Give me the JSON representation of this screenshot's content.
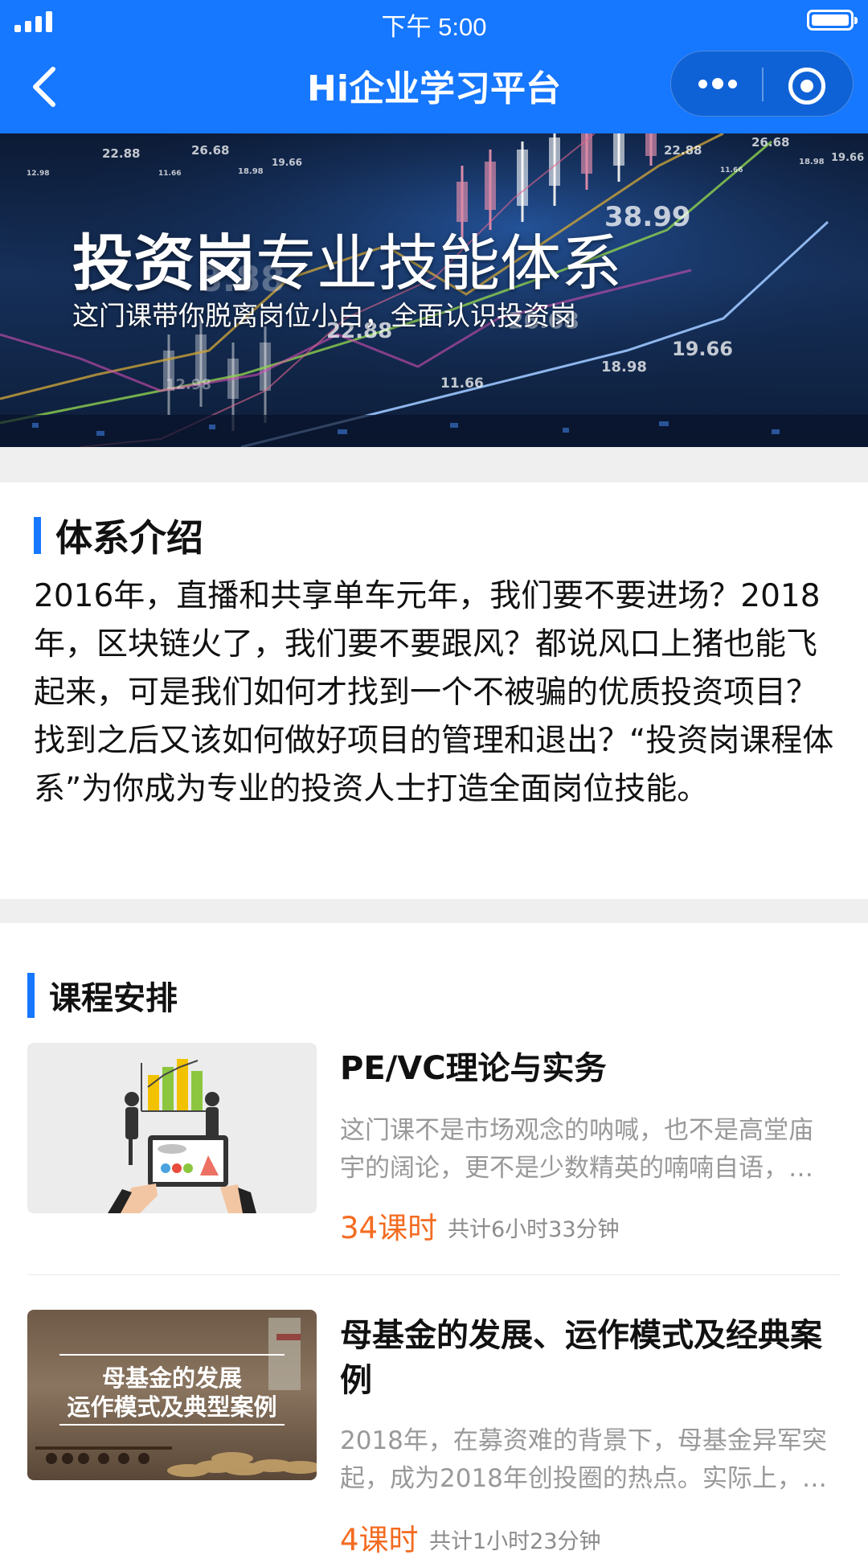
{
  "status_bar": {
    "time": "下午 5:00"
  },
  "nav": {
    "title": "Hi企业学习平台"
  },
  "banner": {
    "title_bold": "投资岗",
    "title_light": "专业技能体系",
    "subtitle": "这门课带你脱离岗位小白，全面认识投资岗",
    "bg_numbers": [
      "22.88",
      "26.68",
      "19.66",
      "18.98",
      "11.66",
      "12.98",
      "38.99",
      "26.68",
      "22.88",
      "19.66",
      "18.98",
      "11.66",
      "22.88",
      "8.88",
      "12.98"
    ]
  },
  "intro": {
    "heading": "体系介绍",
    "text": "2016年，直播和共享单车元年，我们要不要进场？2018年，区块链火了，我们要不要跟风？都说风口上猪也能飞起来，可是我们如何才找到一个不被骗的优质投资项目？找到之后又该如何做好项目的管理和退出？“投资岗课程体系”为你成为专业的投资人士打造全面岗位技能。"
  },
  "schedule": {
    "heading": "课程安排",
    "courses": [
      {
        "title": "PE/VC理论与实务",
        "desc_line1": "这门课不是市场观念的呐喊，也不是高堂庙",
        "desc_line2": "宇的阔论，更不是少数精英的喃喃自语，…",
        "lessons": "34课时",
        "duration": "共计6小时33分钟"
      },
      {
        "title": "母基金的发展、运作模式及经典案例",
        "thumb_line1": "母基金的发展",
        "thumb_line2": "运作模式及典型案例",
        "desc_line1": "2018年，在募资难的背景下，母基金异军突",
        "desc_line2": "起，成为2018年创投圈的热点。实际上，…",
        "lessons": "4课时",
        "duration": "共计1小时23分钟"
      }
    ]
  },
  "colors": {
    "accent": "#1677ff",
    "orange": "#f36c21",
    "muted": "#999999"
  }
}
